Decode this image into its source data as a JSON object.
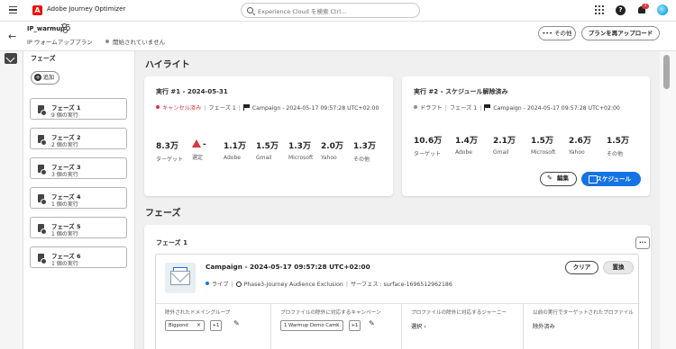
{
  "app": {
    "logo": "A",
    "name": "Adobe Journey Optimizer"
  },
  "search": {
    "placeholder": "Experience Cloud を検索 Ctrl..."
  },
  "topbar_icons": [
    "apps-grid-icon",
    "help-icon",
    "notifications-icon",
    "avatar"
  ],
  "notifications": {
    "count": "1"
  },
  "header": {
    "back_label": "←",
    "plan_name": "IP_warmup",
    "plan_type": "IP ウォームアッププラン",
    "status": "開始されていません",
    "more_label": "その他",
    "reupload_label": "プランを再アップロード"
  },
  "sidebar": {
    "title": "フェーズ",
    "add_label": "追加",
    "phases": [
      {
        "title": "フェーズ 1",
        "count": "9 個の実行"
      },
      {
        "title": "フェーズ 2",
        "count": "2 個の実行"
      },
      {
        "title": "フェーズ 3",
        "count": "3 個の実行"
      },
      {
        "title": "フェーズ 4",
        "count": "1 個の実行"
      },
      {
        "title": "フェーズ 5",
        "count": "1 個の実行"
      },
      {
        "title": "フェーズ 6",
        "count": "1 個の実行"
      }
    ]
  },
  "highlights": {
    "title": "ハイライト",
    "run1": {
      "title": "実行 #1 - 2024-05-31",
      "status": "キャンセル済み",
      "status_color": "#d7373f",
      "phase": "フェーズ 1",
      "campaign": "Campaign - 2024-05-17 09:57:28 UTC+02:00",
      "metrics": [
        {
          "value": "8.3万",
          "label": "ターゲット"
        },
        {
          "value": "-",
          "label": "選定",
          "icon": "warning-icon"
        },
        {
          "value": "1.1万",
          "label": "Adobe"
        },
        {
          "value": "1.5万",
          "label": "Gmail"
        },
        {
          "value": "1.3万",
          "label": "Microsoft"
        },
        {
          "value": "2.0万",
          "label": "Yahoo"
        },
        {
          "value": "1.3万",
          "label": "その他"
        }
      ]
    },
    "run2": {
      "title": "実行 #2 - スケジュール解除済み",
      "status": "ドラフト",
      "status_color": "#8e8e8e",
      "phase": "フェーズ 1",
      "campaign": "Campaign - 2024-05-17 09:57:28 UTC+02:00",
      "metrics": [
        {
          "value": "10.6万",
          "label": "ターゲット"
        },
        {
          "value": "1.4万",
          "label": "Adobe"
        },
        {
          "value": "2.1万",
          "label": "Gmail"
        },
        {
          "value": "1.5万",
          "label": "Microsoft"
        },
        {
          "value": "2.6万",
          "label": "Yahoo"
        },
        {
          "value": "1.5万",
          "label": "その他"
        }
      ],
      "edit_label": "編集",
      "schedule_label": "スケジュール"
    }
  },
  "phases_section": {
    "title": "フェーズ",
    "phase_title": "フェーズ 1",
    "campaign": {
      "title": "Campaign - 2024-05-17 09:57:28 UTC+02:00",
      "status": "ライブ",
      "status_color": "#1473e6",
      "audience": "Phase3-Journey Audience Exclusion",
      "surface": "サーフェス : surface-1696512962186",
      "clear_label": "クリア",
      "replace_label": "置換"
    },
    "columns": [
      {
        "label": "除外されたドメイングループ",
        "chip": "Bigpond",
        "more": "+1"
      },
      {
        "label": "プロファイルの除外に対応するキャンペーン",
        "chip": "1 Warmup Demo Cam...",
        "more": "+1"
      },
      {
        "label": "プロファイルの除外に対応するジャーニー",
        "value": "選択"
      },
      {
        "label": "以前の実行でターゲットされたプロファイル",
        "value": "除外済み"
      }
    ]
  },
  "colors": {
    "accent": "#1473e6",
    "brand": "#eb1000",
    "error": "#d7373f"
  }
}
